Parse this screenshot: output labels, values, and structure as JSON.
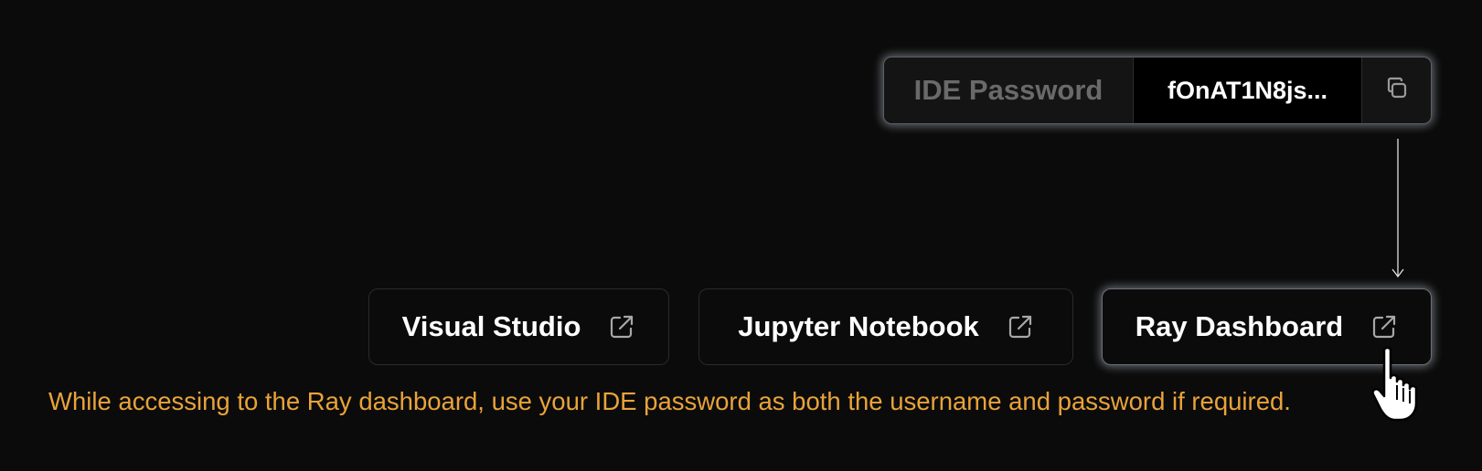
{
  "ide_password": {
    "label": "IDE Password",
    "value": "fOnAT1N8js...",
    "copy_icon": "copy-icon"
  },
  "links": [
    {
      "label": "Visual Studio",
      "icon": "external-link-icon"
    },
    {
      "label": "Jupyter Notebook",
      "icon": "external-link-icon"
    },
    {
      "label": "Ray Dashboard",
      "icon": "external-link-icon"
    }
  ],
  "notice": "While accessing to the Ray dashboard, use your IDE password as both the username and password if required.",
  "colors": {
    "background": "#0b0b0b",
    "notice": "#e9a33a",
    "muted_label": "#6a6a6a",
    "text": "#ffffff"
  }
}
